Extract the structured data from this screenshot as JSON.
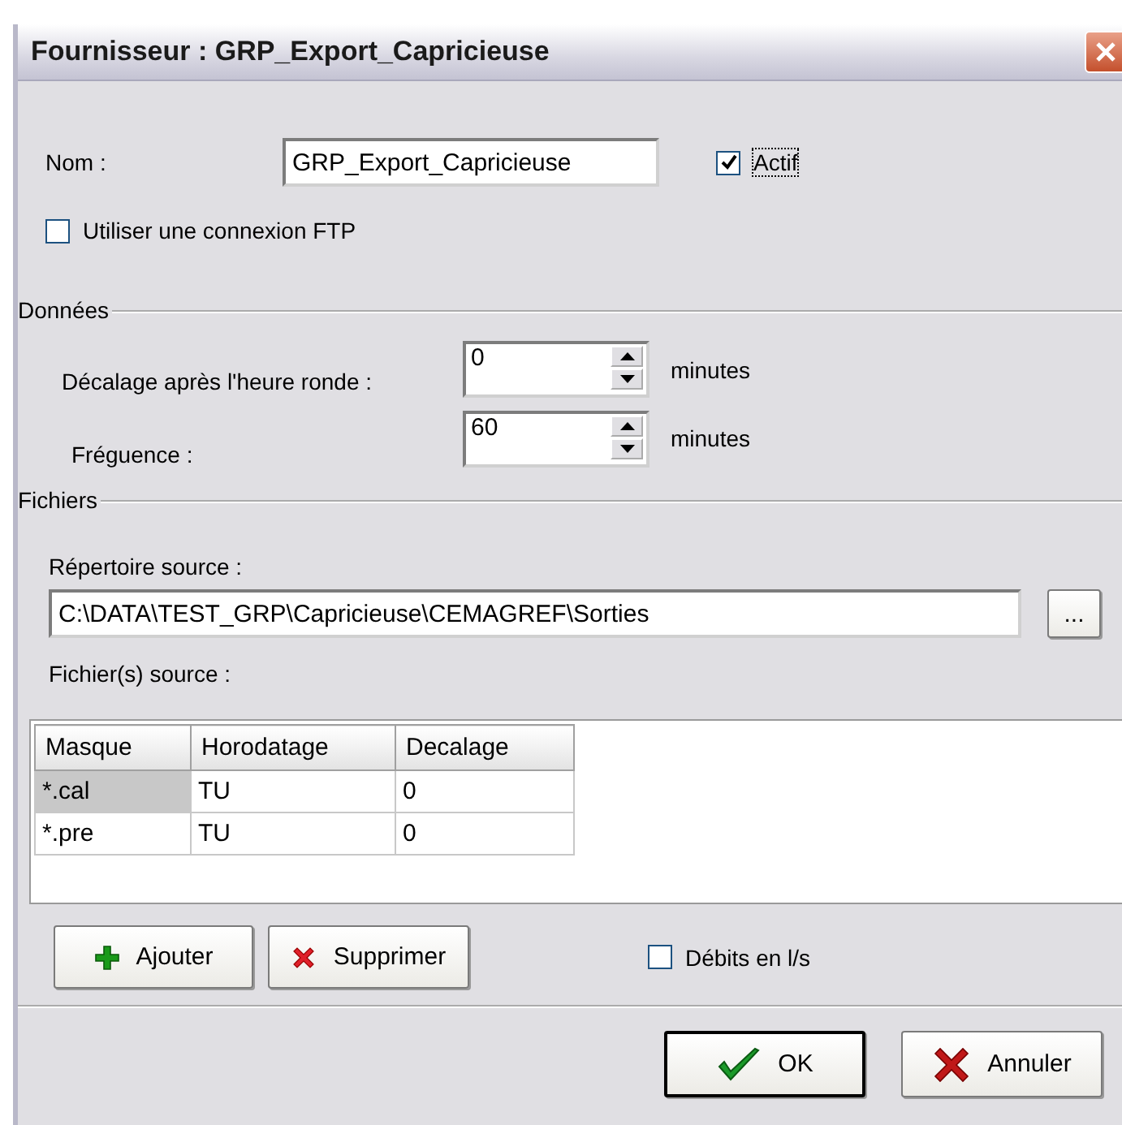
{
  "window": {
    "title": "Fournisseur : GRP_Export_Capricieuse"
  },
  "name": {
    "label": "Nom :",
    "value": "GRP_Export_Capricieuse"
  },
  "active": {
    "label": "Actif",
    "checked": true
  },
  "ftp": {
    "label": "Utiliser une connexion FTP",
    "checked": false
  },
  "data_group": {
    "title": "Données",
    "fields": [
      {
        "label": "Décalage après l'heure ronde :",
        "value": "0",
        "unit": "minutes"
      },
      {
        "label": "Fréguence :",
        "value": "60",
        "unit": "minutes"
      }
    ]
  },
  "files_group": {
    "title": "Fichiers",
    "source_dir": {
      "label": "Répertoire source :",
      "value": "C:\\DATA\\TEST_GRP\\Capricieuse\\CEMAGREF\\Sorties",
      "browse": "..."
    },
    "source_files_label": "Fichier(s) source :",
    "table": {
      "columns": [
        "Masque",
        "Horodatage",
        "Decalage"
      ],
      "rows": [
        {
          "cells": [
            "*.cal",
            "TU",
            "0"
          ],
          "selected": true
        },
        {
          "cells": [
            "*.pre",
            "TU",
            "0"
          ],
          "selected": false
        }
      ]
    },
    "buttons": [
      {
        "kind": "add",
        "label": "Ajouter"
      },
      {
        "kind": "delete",
        "label": "Supprimer"
      }
    ],
    "flow_units": {
      "label": "Débits en l/s",
      "checked": false
    }
  },
  "footer_buttons": [
    {
      "kind": "ok",
      "label": "OK"
    },
    {
      "kind": "cancel",
      "label": "Annuler"
    }
  ]
}
